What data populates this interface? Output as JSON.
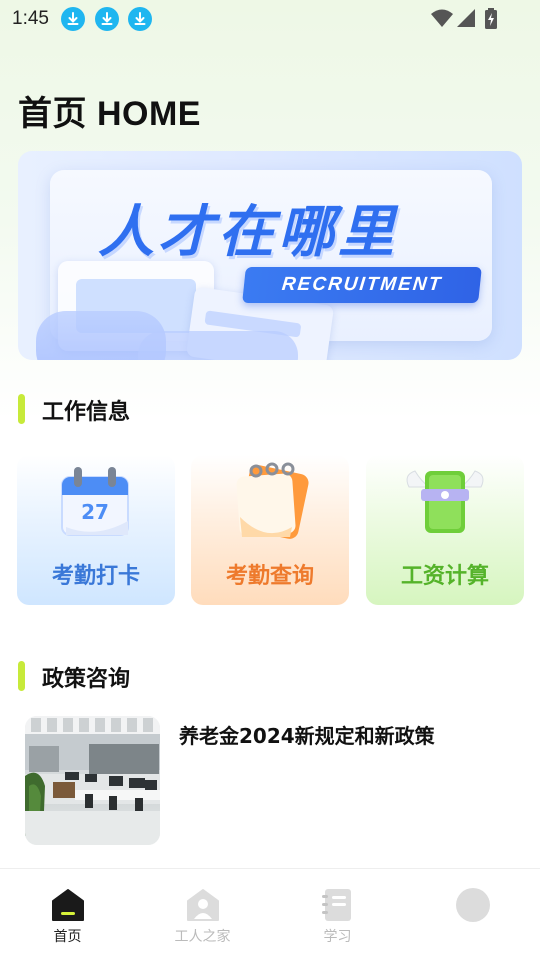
{
  "status_bar": {
    "time": "1:45",
    "notification_icons": [
      "download-icon",
      "download-icon",
      "download-icon"
    ],
    "right_icons": [
      "wifi-icon",
      "cellular-signal-icon",
      "battery-charging-icon"
    ]
  },
  "header": {
    "title": "首页 HOME"
  },
  "banner": {
    "heading": "人才在哪里",
    "subheading": "RECRUITMENT",
    "accent_color": "#2f6ff0"
  },
  "work_section": {
    "title": "工作信息",
    "cards": [
      {
        "label": "考勤打卡",
        "icon": "calendar-icon",
        "color": "#3a78d8"
      },
      {
        "label": "考勤查询",
        "icon": "calendar-note-icon",
        "color": "#ee7a2c"
      },
      {
        "label": "工资计算",
        "icon": "flying-money-icon",
        "color": "#55b32a"
      }
    ]
  },
  "policy_section": {
    "title": "政策咨询",
    "items": [
      {
        "title": "养老金2024新规定和新政策",
        "thumbnail": "office-photo"
      }
    ]
  },
  "bottom_nav": {
    "items": [
      {
        "label": "首页",
        "icon": "home-icon",
        "active": true
      },
      {
        "label": "工人之家",
        "icon": "worker-home-icon",
        "active": false
      },
      {
        "label": "学习",
        "icon": "notebook-icon",
        "active": false
      },
      {
        "label": "",
        "icon": "profile-icon",
        "active": false
      }
    ]
  },
  "colors": {
    "section_bar": "#c7ea3a",
    "status_icon": "#1fb6f0"
  }
}
